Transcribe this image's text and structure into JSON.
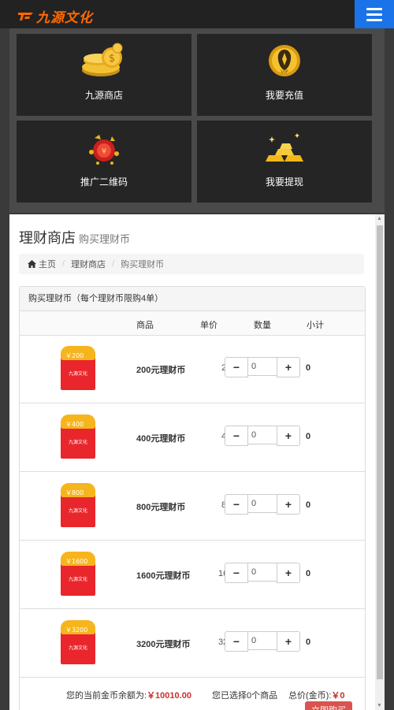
{
  "header": {
    "logo_text": "九源文化"
  },
  "tiles": [
    {
      "label": "九源商店",
      "icon": "coins-icon"
    },
    {
      "label": "我要充值",
      "icon": "vip-coin-icon"
    },
    {
      "label": "推广二维码",
      "icon": "gift-qr-icon"
    },
    {
      "label": "我要提现",
      "icon": "gold-bars-icon"
    }
  ],
  "page": {
    "title": "理财商店",
    "subtitle": "购买理财币"
  },
  "breadcrumb": {
    "home": "主页",
    "shop": "理财商店",
    "current": "购买理财币"
  },
  "panel": {
    "heading": "购买理财币（每个理财币限购4单）",
    "columns": {
      "product": "商品",
      "price": "单价",
      "qty": "数量",
      "subtotal": "小计"
    }
  },
  "products": [
    {
      "envelope": "￥200",
      "name": "200元理财币",
      "price": "200",
      "qty": "0",
      "subtotal": "0"
    },
    {
      "envelope": "￥400",
      "name": "400元理财币",
      "price": "400",
      "qty": "0",
      "subtotal": "0"
    },
    {
      "envelope": "￥800",
      "name": "800元理财币",
      "price": "800",
      "qty": "0",
      "subtotal": "0"
    },
    {
      "envelope": "￥1600",
      "name": "1600元理财币",
      "price": "1600",
      "qty": "0",
      "subtotal": "0"
    },
    {
      "envelope": "￥3200",
      "name": "3200元理财币",
      "price": "3200",
      "qty": "0",
      "subtotal": "0"
    }
  ],
  "envelope_brand": "九源文化",
  "summary": {
    "balance_label": "您的当前金币余额为:",
    "balance_value": "￥10010.00",
    "selected_text": "您已选择0个商品",
    "total_label": "总价(金币):",
    "total_value": "￥0",
    "buy_button": "立即购买"
  },
  "colors": {
    "accent": "#1a73e8",
    "logo": "#ff6a00",
    "danger": "#d9534f"
  }
}
